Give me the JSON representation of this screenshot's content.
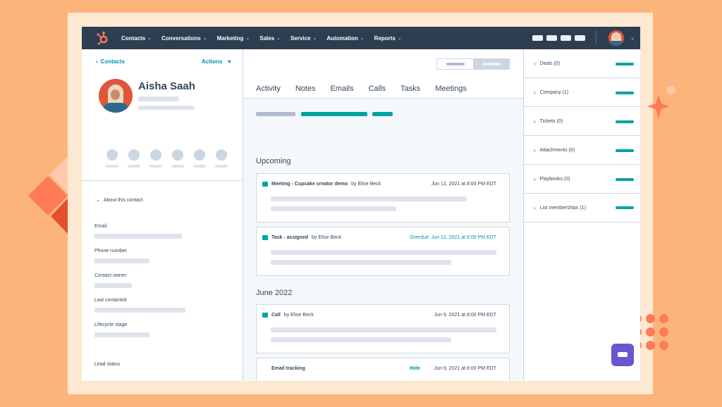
{
  "nav": {
    "items": [
      "Contacts",
      "Conversations",
      "Marketing",
      "Sales",
      "Service",
      "Automation",
      "Reports"
    ],
    "chevron": "⌄"
  },
  "contact": {
    "breadcrumb": "Contacts",
    "actions": "Actions",
    "name": "Aisha Saah",
    "about_title": "About this contact",
    "fields": [
      "Email",
      "Phone number",
      "Contact owner",
      "Last contacted",
      "Lifecycle stage",
      "Lead status"
    ]
  },
  "main": {
    "tabs": [
      "Activity",
      "Notes",
      "Emails",
      "Calls",
      "Tasks",
      "Meetings"
    ],
    "section_upcoming": "Upcoming",
    "section_month": "June 2022",
    "cards": [
      {
        "title": "Meeting - Cupcake creator demo",
        "by": "by Elise Beck",
        "date": "Jun 12, 2021 at 8:00 PM EDT"
      },
      {
        "title": "Task - assigned",
        "by": "by Elise Beck",
        "date": "Overdue: Jun 12, 2021 at 8:00 PM EDT"
      },
      {
        "title": "Call",
        "by": "by Elise Beck",
        "date": "Jun 9, 2021 at 8:00 PM EDT"
      },
      {
        "title": "Email tracking",
        "by": "",
        "hide": "Hide",
        "date": "Jun 9, 2021 at 8:00 PM EDT"
      }
    ]
  },
  "sidebar_right": {
    "items": [
      "Deals (0)",
      "Company (1)",
      "Tickets (0)",
      "Attachments (0)",
      "Playbooks (0)",
      "List memberships (1)"
    ]
  },
  "colors": {
    "nav_bg": "#2d3e50",
    "accent_teal": "#00a4a0",
    "link": "#0091ae",
    "brand_orange": "#ff7a59",
    "background": "#fdb47a"
  },
  "icons": [
    "hubspot-logo-icon",
    "chevron-left-icon",
    "caret-down-icon",
    "chevron-down-icon",
    "chevron-right-icon",
    "task-square-icon",
    "chat-icon",
    "sparkle-icon"
  ]
}
